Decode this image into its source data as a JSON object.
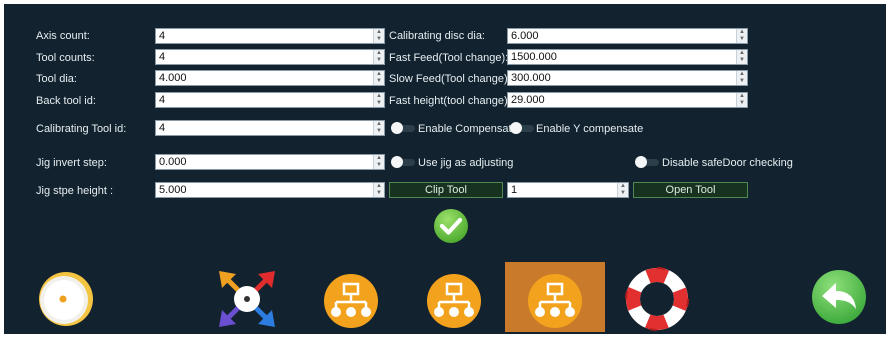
{
  "left_fields": [
    {
      "label": "Axis count:",
      "value": "4"
    },
    {
      "label": "Tool counts:",
      "value": "4"
    },
    {
      "label": "Tool dia:",
      "value": "4.000"
    },
    {
      "label": "Back tool id:",
      "value": "4"
    },
    {
      "label": "Calibrating Tool id:",
      "value": "4"
    },
    {
      "label": "Jig invert step:",
      "value": "0.000"
    },
    {
      "label": "Jig stpe height :",
      "value": "5.000"
    }
  ],
  "right_fields": [
    {
      "label": "Calibrating disc dia:",
      "value": "6.000"
    },
    {
      "label": "Fast Feed(Tool change):",
      "value": "1500.000"
    },
    {
      "label": "Slow Feed(Tool change):",
      "value": "300.000"
    },
    {
      "label": "Fast height(tool change):",
      "value": "29.000"
    }
  ],
  "toggles": {
    "enable_compensation": "Enable Compensation",
    "enable_y_compensate": "Enable Y compensate",
    "use_jig": "Use jig as adjusting",
    "disable_safedoor": "Disable safeDoor checking"
  },
  "clip_tool_label": "Clip Tool",
  "tool_number": "1",
  "open_tool_label": "Open Tool",
  "colors": {
    "panel": "#12222e",
    "selected_toolbar_bg": "#c97a2a",
    "confirm": "#6cc640",
    "back": "#4cc04a"
  },
  "toolbar": [
    {
      "icon": "gauge-icon"
    },
    {
      "icon": "axes-arrows-icon"
    },
    {
      "icon": "network-icon"
    },
    {
      "icon": "network-icon"
    },
    {
      "icon": "network-icon",
      "selected": true
    },
    {
      "icon": "lifebuoy-icon"
    },
    {
      "icon": "back-arrow-icon"
    }
  ]
}
